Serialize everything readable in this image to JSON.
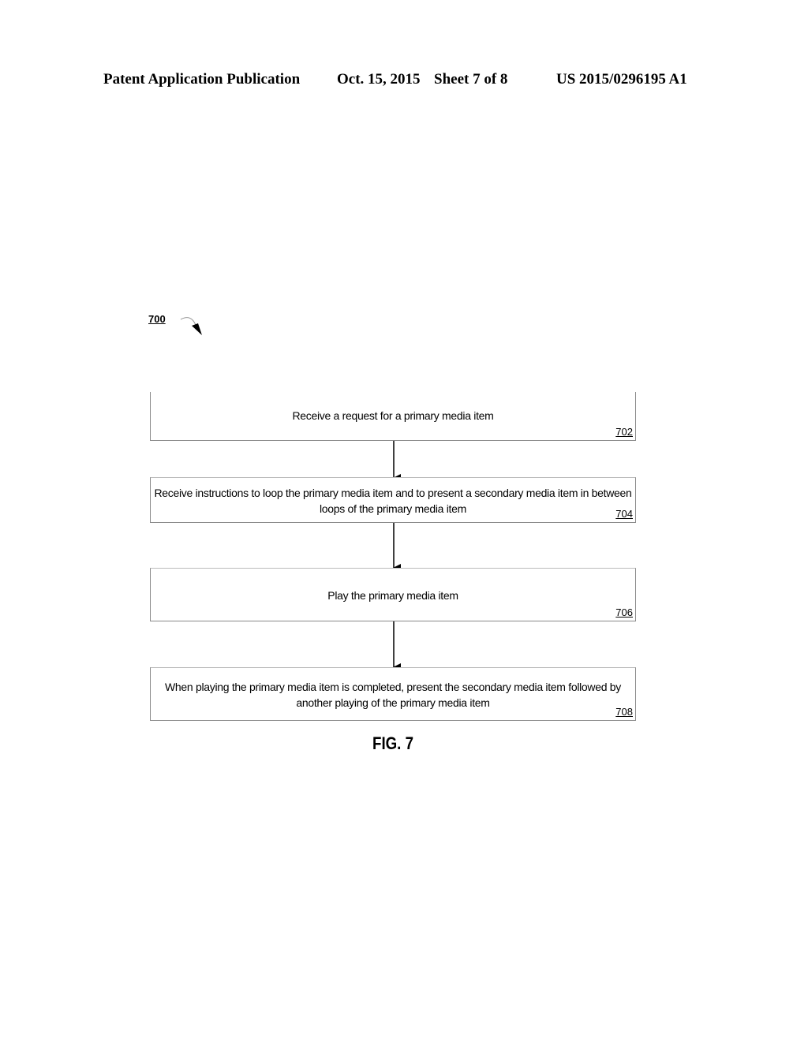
{
  "header": {
    "publication": "Patent Application Publication",
    "date": "Oct. 15, 2015",
    "sheet": "Sheet 7 of 8",
    "number": "US 2015/0296195 A1"
  },
  "figure": {
    "reference": "700",
    "caption": "FIG. 7",
    "steps": [
      {
        "id": "702",
        "text": "Receive a request for a primary media item"
      },
      {
        "id": "704",
        "line1": "Receive instructions to loop the primary media item and to present a secondary media item in between",
        "line2": "loops of the primary media item"
      },
      {
        "id": "706",
        "text": "Play the primary media item"
      },
      {
        "id": "708",
        "line1": "When playing the primary media item is completed, present the secondary media item followed by",
        "line2": "another playing of the primary media item"
      }
    ]
  }
}
